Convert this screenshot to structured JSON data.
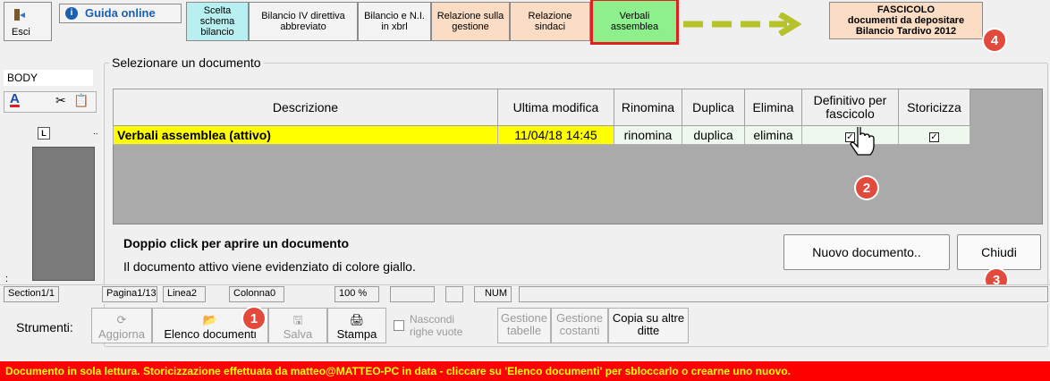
{
  "toolbar": {
    "esci": "Esci",
    "guida": "Guida online",
    "buttons": [
      {
        "label": "Scelta schema bilancio"
      },
      {
        "label": "Bilancio IV direttiva abbreviato"
      },
      {
        "label": "Bilancio e N.I. in xbrl"
      },
      {
        "label": "Relazione sulla gestione"
      },
      {
        "label": "Relazione sindaci"
      },
      {
        "label": "Verbali assemblea"
      }
    ],
    "fascicolo": [
      "FASCICOLO",
      "documenti da depositare",
      "Bilancio Tardivo 2012"
    ]
  },
  "editor_side": {
    "style_box": "BODY",
    "format_a": "A",
    "ruler_l": "L"
  },
  "dialog": {
    "title": "Selezionare un documento",
    "columns": [
      "Descrizione",
      "Ultima modifica",
      "Rinomina",
      "Duplica",
      "Elimina",
      "Definitivo per fascicolo",
      "Storicizza"
    ],
    "rows": [
      {
        "descrizione": "Verbali assemblea (attivo)",
        "ultima_modifica": "11/04/18 14:45",
        "rinomina": "rinomina",
        "duplica": "duplica",
        "elimina": "elimina",
        "definitivo_checked": true,
        "storicizza_checked": true
      }
    ],
    "hint_bold": "Doppio click per aprire un documento",
    "hint_note": "Il documento attivo viene evidenziato di colore giallo.",
    "new_button": "Nuovo documento..",
    "close_button": "Chiudi"
  },
  "statusbar": {
    "section": "Section1/1",
    "page": "Pagina1/13",
    "line": "Linea2",
    "column": "Colonna0",
    "zoom": "100 %",
    "num": "NUM"
  },
  "tools": {
    "label": "Strumenti:",
    "aggiorna": "Aggiorna",
    "elenco": "Elenco documenti",
    "salva": "Salva",
    "stampa": "Stampa",
    "nascondi": "Nascondi righe vuote",
    "gestione_tabelle": "Gestione tabelle",
    "gestione_costanti": "Gestione costanti",
    "copia": "Copia su altre ditte"
  },
  "badges": [
    "1",
    "2",
    "3",
    "4"
  ],
  "bottom_message": "Documento in sola lettura. Storicizzazione effettuata da matteo@MATTEO-PC in data  - cliccare su 'Elenco documenti' per sbloccarlo o crearne uno nuovo.",
  "colors": {
    "active_row": "#ffff00",
    "message_bar": "#ff0000",
    "message_text": "#ffff00",
    "badge": "#e24a3b"
  }
}
